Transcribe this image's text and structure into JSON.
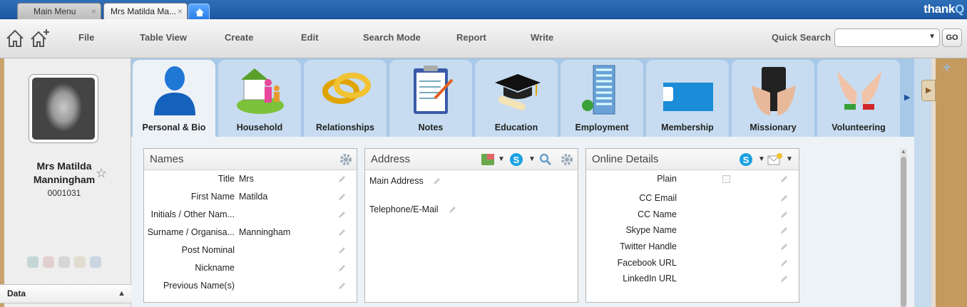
{
  "tabs": [
    {
      "label": "Main Menu",
      "close": "×"
    },
    {
      "label": "Mrs Matilda Ma...",
      "close": "×"
    }
  ],
  "brand": {
    "main": "thank",
    "accent": "Q"
  },
  "toolbar": {
    "menus": [
      "File",
      "Table View",
      "Create",
      "Edit",
      "Search Mode",
      "Report",
      "Write"
    ],
    "quick_search_label": "Quick Search",
    "quick_search_value": "",
    "go_label": "GO"
  },
  "person": {
    "name": "Mrs Matilda Manningham",
    "id": "0001031",
    "favorite_icon": "star-icon"
  },
  "left_section": {
    "label": "Data"
  },
  "modules": [
    {
      "label": "Personal & Bio",
      "icon": "person-icon",
      "active": true
    },
    {
      "label": "Household",
      "icon": "household-icon"
    },
    {
      "label": "Relationships",
      "icon": "rings-icon"
    },
    {
      "label": "Notes",
      "icon": "clipboard-icon"
    },
    {
      "label": "Education",
      "icon": "graduation-cap-icon"
    },
    {
      "label": "Employment",
      "icon": "building-icon"
    },
    {
      "label": "Membership",
      "icon": "membership-card-icon"
    },
    {
      "label": "Missionary",
      "icon": "bible-icon"
    },
    {
      "label": "Volunteering",
      "icon": "hands-icon"
    }
  ],
  "names_panel": {
    "title": "Names",
    "rows": [
      {
        "label": "Title",
        "value": "Mrs"
      },
      {
        "label": "First Name",
        "value": "Matilda"
      },
      {
        "label": "Initials / Other Nam...",
        "value": ""
      },
      {
        "label": "Surname / Organisa...",
        "value": "Manningham"
      },
      {
        "label": "Post Nominal",
        "value": ""
      },
      {
        "label": "Nickname",
        "value": ""
      },
      {
        "label": "Previous Name(s)",
        "value": ""
      }
    ]
  },
  "address_panel": {
    "title": "Address",
    "rows": [
      {
        "label": "Main Address"
      },
      {
        "label": "Telephone/E-Mail"
      }
    ]
  },
  "online_panel": {
    "title": "Online Details",
    "rows": [
      {
        "label": "Plain",
        "type": "checkbox",
        "checked": false
      },
      {
        "label": "CC Email"
      },
      {
        "label": "CC Name"
      },
      {
        "label": "Skype Name"
      },
      {
        "label": "Twitter Handle"
      },
      {
        "label": "Facebook URL"
      },
      {
        "label": "LinkedIn URL"
      }
    ]
  },
  "colors": {
    "accent_blue": "#1e58a3",
    "skype_blue": "#1ba1e2",
    "module_bg": "#c7dcf0"
  }
}
